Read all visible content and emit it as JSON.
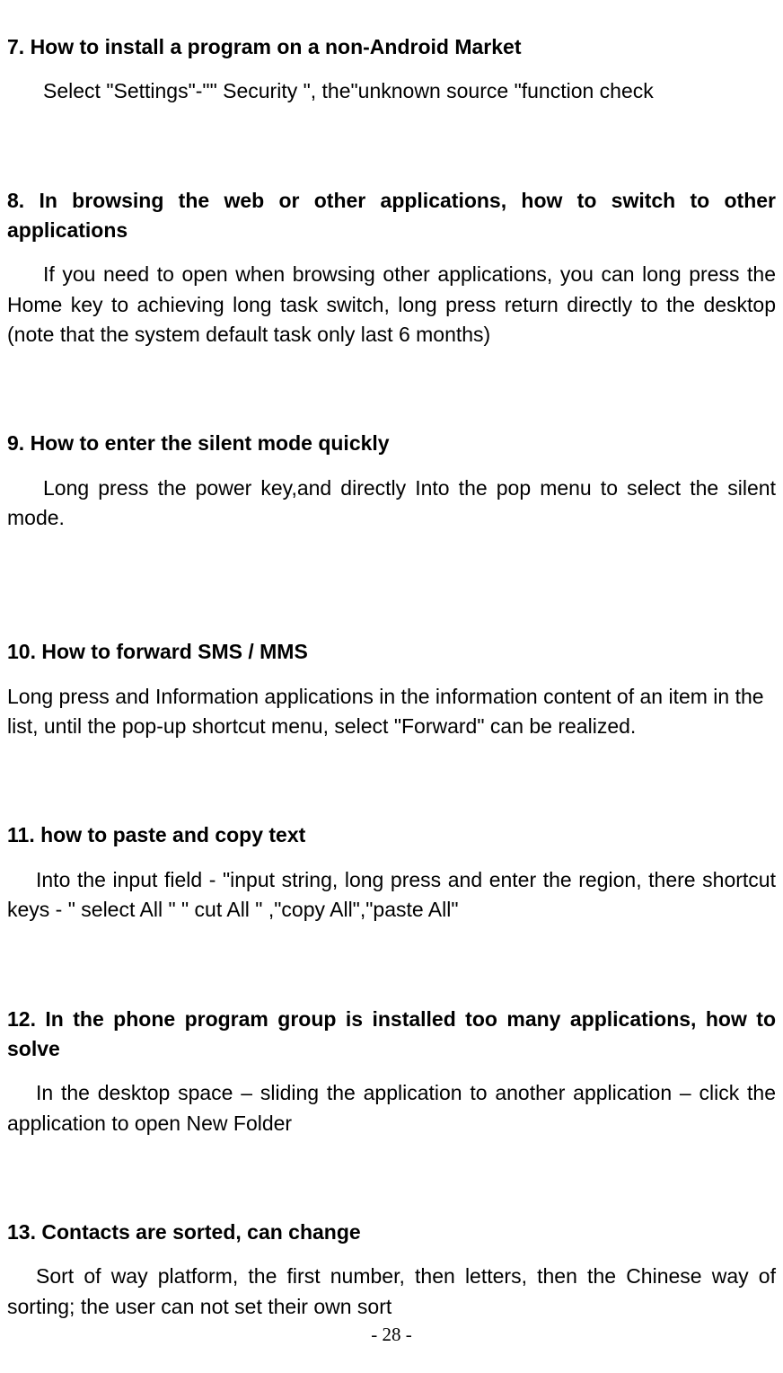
{
  "sections": [
    {
      "heading": "7. How to install a program on a non-Android Market",
      "body": "Select \"Settings\"-\"\" Security \", the\"unknown source \"function check"
    },
    {
      "heading": "8. In browsing the web or other applications, how to switch to other applications",
      "body": "If you need to open when browsing other applications, you can long press the Home key to achieving long task switch, long press return directly to the desktop (note that the system default task only last 6 months)"
    },
    {
      "heading": "9. How to enter the silent mode quickly",
      "body": "Long press the power key,and directly Into the pop menu to select the silent mode."
    },
    {
      "heading": "10. How to forward SMS / MMS",
      "body": "Long press and Information applications in the information content of an item in the list, until the pop-up shortcut menu, select \"Forward\" can be realized."
    },
    {
      "heading": "11. how to paste and copy text",
      "body": "Into the input field - \"input string, long press and enter the region, there shortcut keys - \" select All \" \" cut All \" ,\"copy All\",\"paste All\""
    },
    {
      "heading": "12. In the phone program group is installed too many applications, how to solve",
      "body": "In the desktop space – sliding the application to another application – click the application to open New Folder"
    },
    {
      "heading": "13. Contacts are sorted, can change",
      "body": "Sort of way platform, the first number, then letters, then the Chinese way of sorting; the user can not set their own sort"
    }
  ],
  "pageNumber": "- 28 -"
}
